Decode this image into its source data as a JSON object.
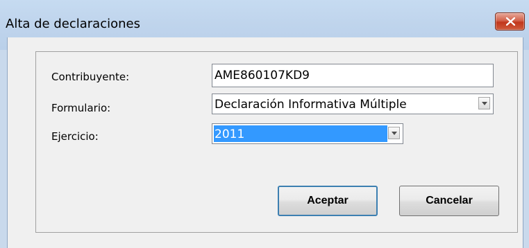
{
  "window": {
    "title": "Alta de declaraciones"
  },
  "form": {
    "contribuyente_label": "Contribuyente:",
    "contribuyente_value": "AME860107KD9",
    "formulario_label": "Formulario:",
    "formulario_value": "Declaración Informativa Múltiple",
    "ejercicio_label": "Ejercicio:",
    "ejercicio_value": "2011"
  },
  "buttons": {
    "accept": "Aceptar",
    "cancel": "Cancelar"
  },
  "icons": {
    "close": "close-icon",
    "dropdown": "chevron-down-icon"
  },
  "colors": {
    "selection": "#3399ff",
    "close_button": "#c1371c",
    "title_bar": "#bfd4ec"
  }
}
